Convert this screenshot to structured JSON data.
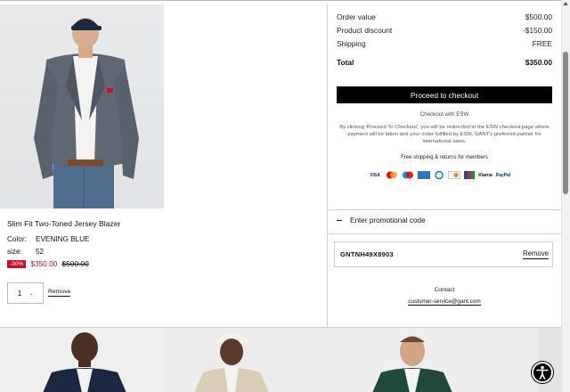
{
  "product": {
    "name": "Slim Fit Two-Toned Jersey Blazer",
    "color_label": "Color:",
    "color_value": "EVENING BLUE",
    "size_label": "size:",
    "size_value": "52",
    "discount_badge": "-30%",
    "sale_price": "$350.00",
    "original_price": "$500.00",
    "quantity": "1",
    "remove_label": "Remove",
    "image_icon": "product-photo"
  },
  "summary": {
    "order_value_label": "Order value",
    "order_value": "$500.00",
    "discount_label": "Product discount",
    "discount_value": "-$150.00",
    "shipping_label": "Shipping",
    "shipping_value": "FREE",
    "total_label": "Total",
    "total_value": "$350.00",
    "checkout_button": "Proceed to checkout",
    "checkout_with": "Checkout with ESW",
    "disclaimer": "By clicking 'Proceed To Checkout', you will be redirected to the ESW checkout page where payment will be taken and your order fulfilled by ESW, GANT's preferred partner for international sales.",
    "free_shipping": "Free shipping & returns for members",
    "payment_methods": [
      "VISA",
      "Mastercard",
      "Maestro",
      "Amex",
      "Diners",
      "Discover",
      "JCB",
      "Klarna",
      "PayPal"
    ]
  },
  "promo": {
    "toggle_label": "Enter promotional code",
    "code": "GNTNH49X8903",
    "remove_label": "Remove"
  },
  "contact": {
    "label": "Contact",
    "email": "customer-service@gant.com"
  },
  "colors": {
    "sale_red": "#c8102e",
    "button_black": "#000000"
  }
}
